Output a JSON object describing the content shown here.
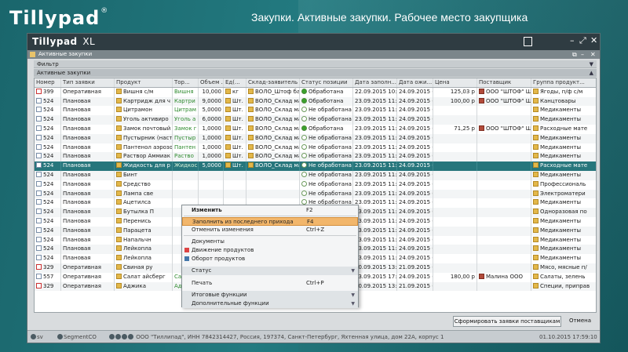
{
  "app": {
    "logo": "Tillypad",
    "logo_mark": "®",
    "page_title": "Закупки. Активные закупки. Рабочее место закупщика"
  },
  "window": {
    "brand": "Tillypad",
    "brand_suffix": "XL",
    "subtitle": "Активные закупки",
    "filter_label": "Фильтр",
    "active_label": "Активные закупки"
  },
  "columns": [
    "Номер",
    "Тип заявки",
    "Продукт",
    "Тор...",
    "Объем ...",
    "Ед(...",
    "Склад-заявитель",
    "Статус позиции",
    "Дата заполн...",
    "Дата ожи...",
    "Цена",
    "Поставщик",
    "Группа продукт..."
  ],
  "rows": [
    [
      "399",
      "Оперативная",
      "Вишня с/м",
      "Вишня",
      "10,000",
      "кг",
      "ВОЛО_Штоф бар",
      "Обработана",
      "22.09.2015 10:4",
      "24.09.2015 (",
      "125,03 р",
      "ООО \"ШТОФ\" ШТ",
      "Ягоды, п/ф с/м",
      "ok"
    ],
    [
      "524",
      "Плановая",
      "Картридж для ч",
      "Картри",
      "9,0000",
      "Шт.",
      "ВОЛО_Склад ма",
      "Обработана",
      "23.09.2015 11:5",
      "24.09.2015 (",
      "100,00 р",
      "ООО \"ШТОФ\" ШТ",
      "Канцтовары",
      "ok"
    ],
    [
      "524",
      "Плановая",
      "Цитрамон",
      "Цитрам",
      "5,0000",
      "Шт.",
      "ВОЛО_Склад ма",
      "Не обработана",
      "23.09.2015 11:5",
      "24.09.2015 (",
      "",
      "",
      "Медикаменты",
      "no"
    ],
    [
      "524",
      "Плановая",
      "Уголь активиро",
      "Уголь а",
      "6,0000",
      "Шт.",
      "ВОЛО_Склад ма",
      "Не обработана",
      "23.09.2015 11:5",
      "24.09.2015 (",
      "",
      "",
      "Медикаменты",
      "no"
    ],
    [
      "524",
      "Плановая",
      "Замок почтовый",
      "Замок г",
      "1,0000",
      "Шт.",
      "ВОЛО_Склад ма",
      "Обработана",
      "23.09.2015 11:5",
      "24.09.2015 (",
      "71,25 р",
      "ООО \"ШТОФ\" ШТ",
      "Расходные мате",
      "ok"
    ],
    [
      "524",
      "Плановая",
      "Пустырник (наст",
      "Пустыр",
      "1,0000",
      "Шт.",
      "ВОЛО_Склад ма",
      "Не обработана",
      "23.09.2015 11:5",
      "24.09.2015 (",
      "",
      "",
      "Медикаменты",
      "no"
    ],
    [
      "524",
      "Плановая",
      "Пантенол аэрозо",
      "Пантен",
      "1,0000",
      "Шт.",
      "ВОЛО_Склад ма",
      "Не обработана",
      "23.09.2015 11:5",
      "24.09.2015 (",
      "",
      "",
      "Медикаменты",
      "no"
    ],
    [
      "524",
      "Плановая",
      "Раствор Аммиак",
      "Раство",
      "1,0000",
      "Шт.",
      "ВОЛО_Склад ма",
      "Не обработана",
      "23.09.2015 11:5",
      "24.09.2015 (",
      "",
      "",
      "Медикаменты",
      "no"
    ],
    [
      "524",
      "Плановая",
      "Жидкость для р",
      "Жидкос",
      "5,0000",
      "Шт.",
      "ВОЛО_Склад ма",
      "Не обработана",
      "23.09.2015 11:5",
      "24.09.2015 (",
      "",
      "",
      "Расходные мате",
      "no"
    ],
    [
      "524",
      "Плановая",
      "Бинт",
      "",
      "",
      "",
      "",
      "Не обработана",
      "23.09.2015 11:5",
      "24.09.2015 (",
      "",
      "",
      "Медикаменты",
      "no"
    ],
    [
      "524",
      "Плановая",
      "Средство",
      "",
      "",
      "",
      "",
      "Не обработана",
      "23.09.2015 11:5",
      "24.09.2015 (",
      "",
      "",
      "Профессиональ",
      "no"
    ],
    [
      "524",
      "Плановая",
      "Лампа све",
      "",
      "",
      "",
      "",
      "Не обработана",
      "23.09.2015 11:5",
      "24.09.2015 (",
      "",
      "",
      "Электроматери",
      "no"
    ],
    [
      "524",
      "Плановая",
      "Ацетилса",
      "",
      "",
      "",
      "",
      "Не обработана",
      "23.09.2015 11:5",
      "24.09.2015 (",
      "",
      "",
      "Медикаменты",
      "no"
    ],
    [
      "524",
      "Плановая",
      "Бутылка П",
      "",
      "",
      "",
      "",
      "Не обработана",
      "23.09.2015 11:5",
      "24.09.2015 (",
      "",
      "",
      "Одноразовая по",
      "no"
    ],
    [
      "524",
      "Плановая",
      "Перенись",
      "",
      "",
      "",
      "",
      "Не обработана",
      "23.09.2015 11:5",
      "24.09.2015 (",
      "",
      "",
      "Медикаменты",
      "no"
    ],
    [
      "524",
      "Плановая",
      "Парацета",
      "",
      "",
      "",
      "",
      "Не обработана",
      "23.09.2015 11:5",
      "24.09.2015 (",
      "",
      "",
      "Медикаменты",
      "no"
    ],
    [
      "524",
      "Плановая",
      "Напальчн",
      "",
      "",
      "",
      "",
      "Не обработана",
      "23.09.2015 11:5",
      "24.09.2015 (",
      "",
      "",
      "Медикаменты",
      "no"
    ],
    [
      "524",
      "Плановая",
      "Лейкопла",
      "",
      "",
      "",
      "",
      "Не обработана",
      "23.09.2015 11:5",
      "24.09.2015 (",
      "",
      "",
      "Медикаменты",
      "no"
    ],
    [
      "524",
      "Плановая",
      "Лейкопла",
      "",
      "",
      "",
      "",
      "Не обработана",
      "23.09.2015 11:5",
      "24.09.2015 (",
      "",
      "",
      "Медикаменты",
      "no"
    ],
    [
      "329",
      "Оперативная",
      "Свиная ру",
      "",
      "",
      "",
      "",
      "Не обработана",
      "20.09.2015 13:2",
      "21.09.2015 (",
      "",
      "",
      "Мясо, мясные п/",
      "no"
    ],
    [
      "557",
      "Оперативная",
      "Салат айсберг",
      "Салат а",
      "10,000",
      "кг",
      "ВОЛО_Склад",
      "Обработана",
      "23.09.2015 17:2",
      "24.09.2015 (",
      "180,00 р",
      "Малина ООО",
      "Салаты, зелень",
      "ok"
    ],
    [
      "329",
      "Оперативная",
      "Аджика",
      "Аджика",
      "1,000",
      "кг",
      "ВОЛО_Склад",
      "Не обработана",
      "20.09.2015 13:2",
      "21.09.2015 (",
      "",
      "",
      "Специи, приправ",
      "no"
    ]
  ],
  "context_menu": {
    "edit": "Изменить",
    "edit_sc": "F2",
    "fill": "Заполнить из последнего прихода",
    "fill_sc": "F4",
    "undo": "Отменить изменения",
    "undo_sc": "Ctrl+Z",
    "docs": "Документы",
    "movement": "Движение продуктов",
    "turnover": "Оборот продуктов",
    "status": "Статус",
    "print": "Печать",
    "print_sc": "Ctrl+P",
    "totals": "Итоговые функции",
    "extra": "Дополнительные функции"
  },
  "buttons": {
    "form_orders": "Сформировать заявки поставщикам",
    "cancel": "Отмена"
  },
  "statusbar": {
    "user": "sv",
    "segment": "SegmentCO",
    "company": "ООО \"Тиллипад\", ИНН 7842314427, Россия, 197374, Санкт-Петербург, Яхтенная улица, дом 22А, корпус 1",
    "datetime": "01.10.2015   17:59:10"
  },
  "colors": {
    "accent": "#27767c",
    "background": "#1d6b70",
    "titlebar": "#2f3c42",
    "highlight": "#f2b66b"
  }
}
